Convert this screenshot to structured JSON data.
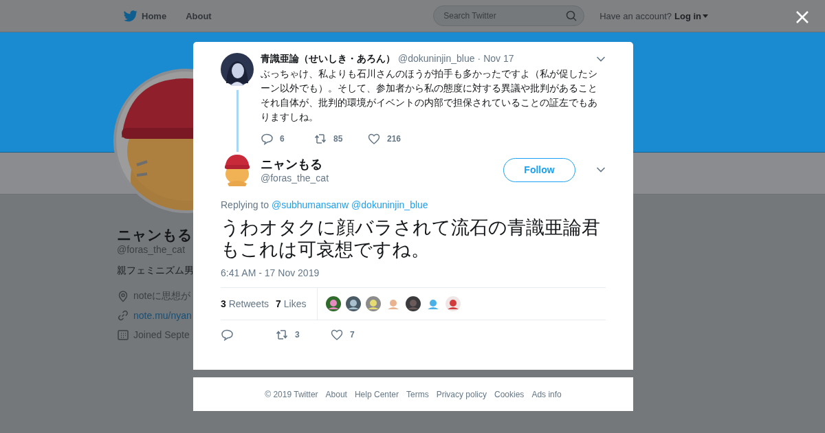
{
  "top_bar": {
    "links": [
      {
        "label": "Home",
        "kind": "home"
      },
      {
        "label": "About",
        "kind": "plain"
      }
    ],
    "search": {
      "placeholder": "Search Twitter"
    },
    "account_prompt": "Have an account?",
    "login": "Log in"
  },
  "profile": {
    "name": "ニャンもる",
    "handle": "@foras_the_cat",
    "bio": "親フェミニズム男",
    "details": [
      {
        "kind": "location",
        "text": "noteに思想が"
      },
      {
        "kind": "link",
        "text": "note.mu/nyan"
      },
      {
        "kind": "joined",
        "text": "Joined Septe"
      }
    ]
  },
  "modal": {
    "parent_tweet": {
      "name": "青識亜論（せいしき・あろん）",
      "handle": "@dokuninjin_blue",
      "separator": "·",
      "date": "Nov 17",
      "text": "ぶっちゃけ、私よりも石川さんのほうが拍手も多かったですよ（私が促したシーン以外でも）。そして、参加者から私の態度に対する異議や批判があることそれ自体が、批判的環境がイベントの内部で担保されていることの証左でもありますしね。",
      "actions": [
        {
          "kind": "reply",
          "count": "6"
        },
        {
          "kind": "retweet",
          "count": "85"
        },
        {
          "kind": "like",
          "count": "216"
        }
      ]
    },
    "tweet": {
      "name": "ニャンもる",
      "handle": "@foras_the_cat",
      "follow_button": "Follow",
      "replying_label": "Replying to",
      "replying_to": [
        "@subhumansanw",
        "@dokuninjin_blue"
      ],
      "text": "うわオタクに顔バラされて流石の青識亜論君もこれは可哀想ですね。",
      "timestamp": "6:41 AM - 17 Nov 2019",
      "stats": [
        {
          "count": "3",
          "label": "Retweets"
        },
        {
          "count": "7",
          "label": "Likes"
        }
      ],
      "likers": [
        {
          "kind": "picture"
        },
        {
          "kind": "picture"
        },
        {
          "kind": "picture"
        },
        {
          "kind": "picture"
        },
        {
          "kind": "picture"
        },
        {
          "kind": "picture"
        },
        {
          "kind": "picture"
        }
      ],
      "actions": [
        {
          "kind": "reply"
        },
        {
          "kind": "retweet",
          "count": "3"
        },
        {
          "kind": "like",
          "count": "7"
        }
      ]
    }
  },
  "footer": {
    "links": [
      "© 2019 Twitter",
      "About",
      "Help Center",
      "Terms",
      "Privacy policy",
      "Cookies",
      "Ads info"
    ]
  }
}
